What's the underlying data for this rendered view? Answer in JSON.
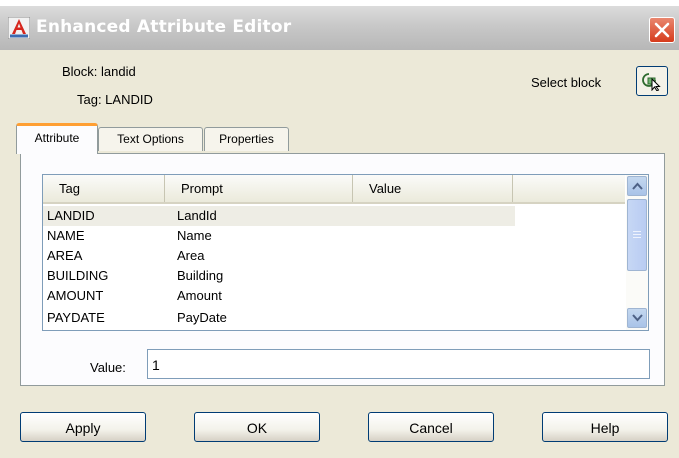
{
  "window": {
    "title": "Enhanced Attribute Editor",
    "app_icon": "autocad-a-icon",
    "close_icon": "close-icon"
  },
  "info": {
    "block": "Block: landid",
    "tag": "Tag: LANDID",
    "select_block_label": "Select block",
    "select_block_icon": "select-block-icon"
  },
  "tabs": [
    {
      "label": "Attribute",
      "active": true
    },
    {
      "label": "Text Options",
      "active": false
    },
    {
      "label": "Properties",
      "active": false
    }
  ],
  "attributes_table": {
    "columns": [
      "Tag",
      "Prompt",
      "Value"
    ],
    "rows": [
      {
        "tag": "LANDID",
        "prompt": "LandId",
        "value": "",
        "selected": true
      },
      {
        "tag": "NAME",
        "prompt": "Name",
        "value": ""
      },
      {
        "tag": "AREA",
        "prompt": "Area",
        "value": ""
      },
      {
        "tag": "BUILDING",
        "prompt": "Building",
        "value": ""
      },
      {
        "tag": "AMOUNT",
        "prompt": "Amount",
        "value": ""
      },
      {
        "tag": "PAYDATE",
        "prompt": "PayDate",
        "value": ""
      }
    ]
  },
  "value_field": {
    "label": "Value:",
    "value": "1"
  },
  "buttons": {
    "apply": "Apply",
    "ok": "OK",
    "cancel": "Cancel",
    "help": "Help"
  },
  "colors": {
    "dialog_bg": "#ece9d8",
    "close_red": "#d63b1c",
    "tab_accent": "#ff9f33",
    "selected_row": "#eeede5"
  }
}
